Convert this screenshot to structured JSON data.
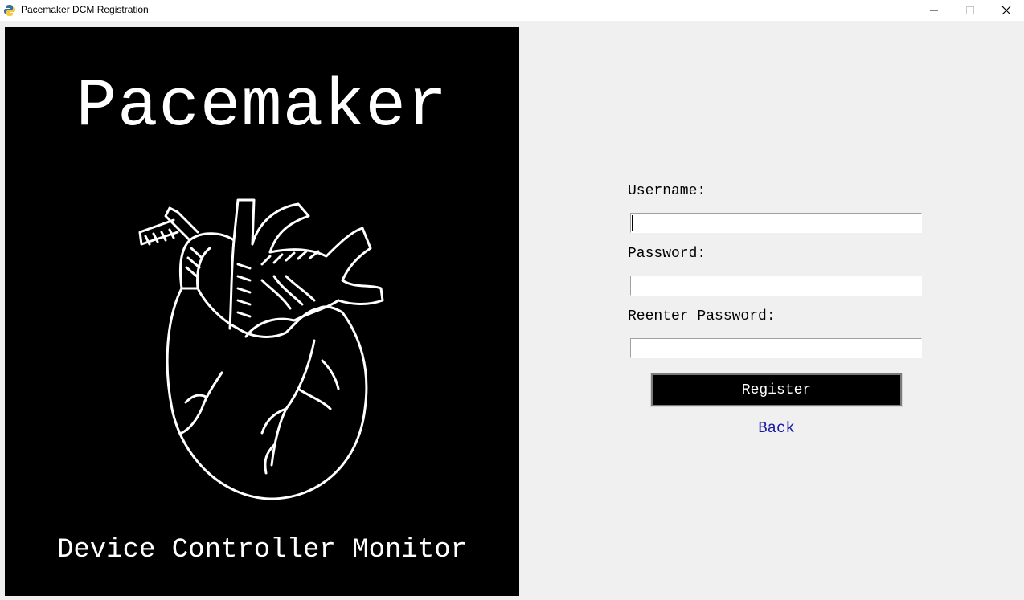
{
  "window": {
    "title": "Pacemaker DCM Registration",
    "controls": {
      "minimize": "minimize-icon",
      "maximize": "maximize-icon",
      "close": "close-icon"
    }
  },
  "banner": {
    "title": "Pacemaker",
    "subtitle": "Device Controller Monitor",
    "image": "heart-illustration"
  },
  "form": {
    "username_label": "Username:",
    "username_value": "",
    "password_label": "Password:",
    "password_value": "",
    "reenter_label": "Reenter Password:",
    "reenter_value": "",
    "register_label": "Register",
    "back_label": "Back"
  },
  "colors": {
    "window_bg": "#f0f0f0",
    "banner_bg": "#000000",
    "button_bg": "#000000",
    "link": "#1a1aa6"
  }
}
